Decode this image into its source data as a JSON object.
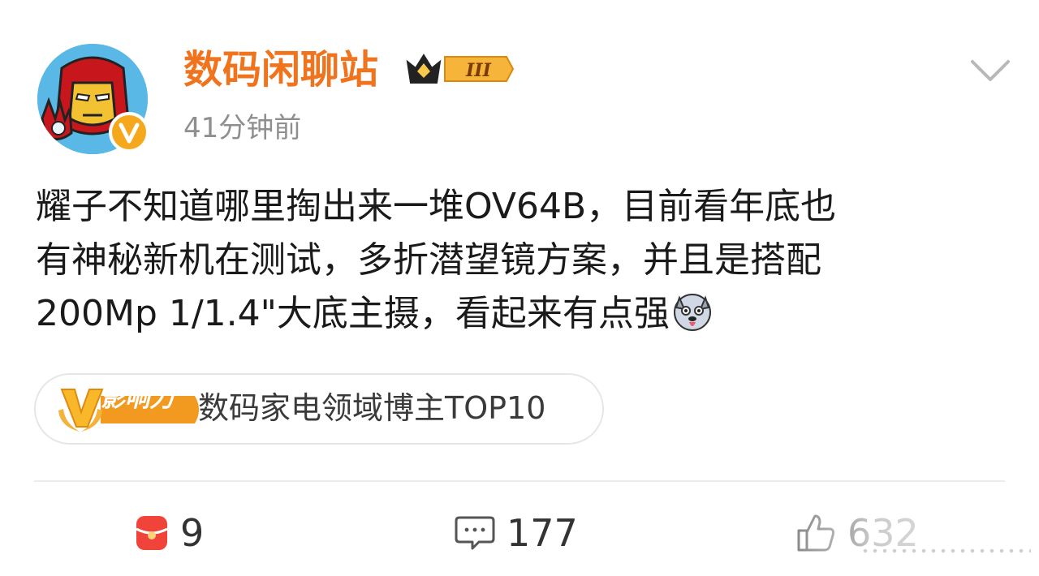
{
  "post": {
    "author": {
      "name": "数码闲聊站",
      "rank_badge": "III",
      "time": "41分钟前"
    },
    "body_lines": [
      "耀子不知道哪里掏出来一堆OV64B，目前看年底也",
      "有神秘新机在测试，多折潜望镜方案，并且是搭配",
      "200Mp 1/1.4\"大底主摄，看起来有点强"
    ],
    "influence": {
      "badge_text": "影响力",
      "label": "数码家电领域博主TOP10"
    },
    "actions": {
      "repost_count": "9",
      "comment_count": "177",
      "like_count": "632"
    }
  },
  "colors": {
    "author_name": "#f0731e",
    "badge_gold": "#f4a62a",
    "repost_red": "#f0443a"
  },
  "icons": {
    "more": "chevron-down-icon",
    "repost": "repost-icon",
    "comment": "comment-icon",
    "like": "thumbs-up-icon"
  }
}
